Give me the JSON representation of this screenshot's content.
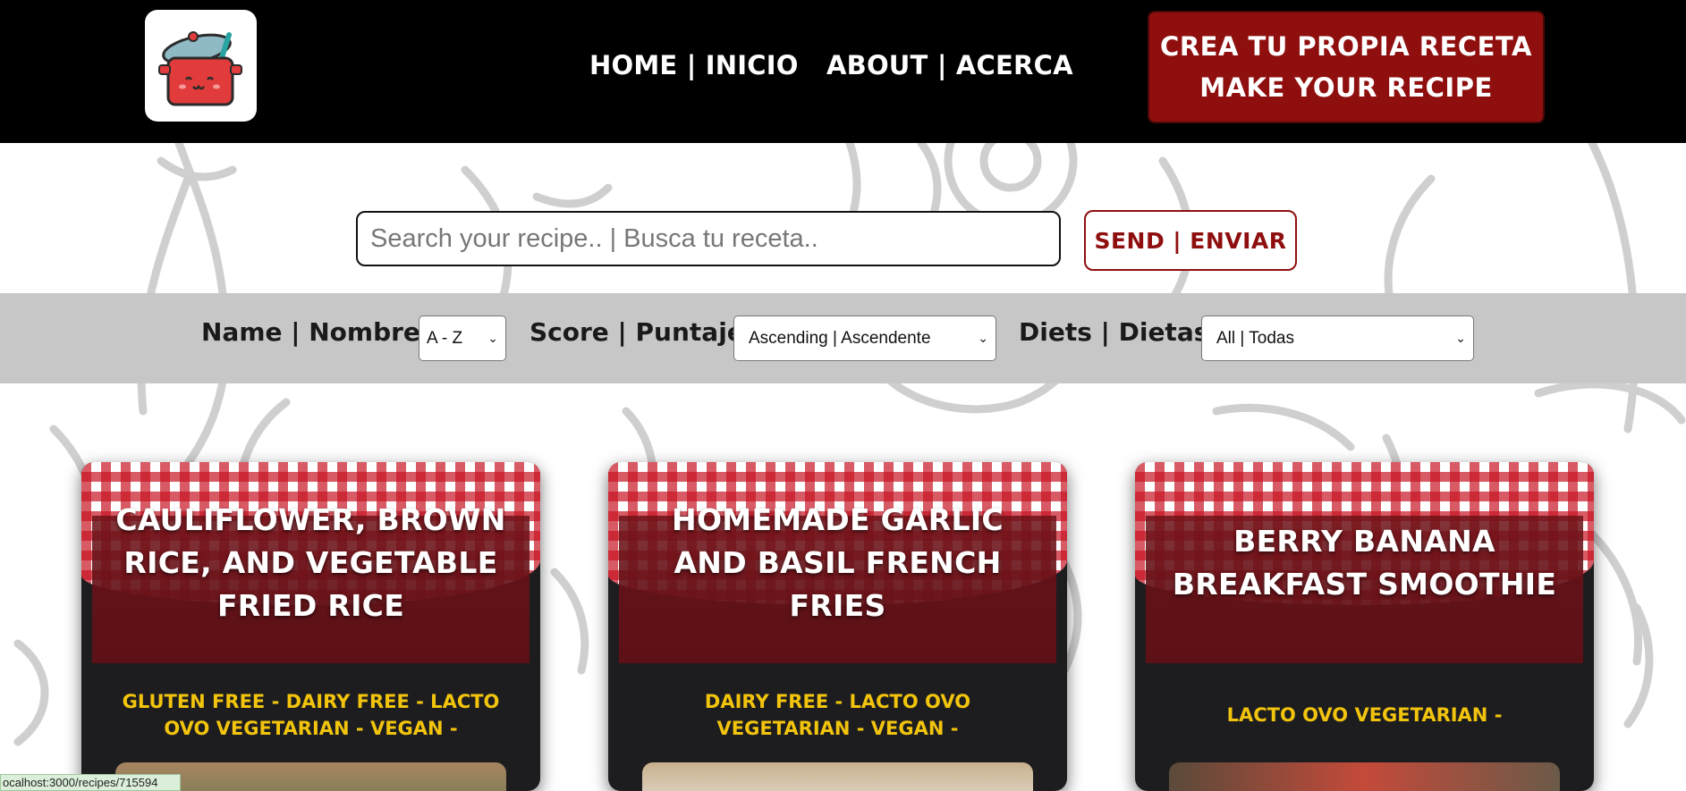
{
  "header": {
    "nav": [
      {
        "label": "HOME | INICIO"
      },
      {
        "label": "ABOUT | ACERCA"
      }
    ],
    "cta_line1": "CREA TU PROPIA RECETA",
    "cta_line2": "MAKE YOUR RECIPE"
  },
  "search": {
    "placeholder": "Search your recipe.. | Busca tu receta..",
    "send_label": "SEND | ENVIAR"
  },
  "filters": {
    "name_label": "Name | Nombre",
    "name_value": "A - Z",
    "score_label": "Score | Puntaje",
    "score_value": "Ascending | Ascendente",
    "diets_label": "Diets | Dietas",
    "diets_value": "All | Todas"
  },
  "cards": [
    {
      "title": "CAULIFLOWER, BROWN RICE, AND VEGETABLE FRIED RICE",
      "diets": "GLUTEN FREE - DAIRY FREE - LACTO OVO VEGETARIAN - VEGAN -"
    },
    {
      "title": "HOMEMADE GARLIC AND BASIL FRENCH FRIES",
      "diets": "DAIRY FREE - LACTO OVO VEGETARIAN - VEGAN -"
    },
    {
      "title": "BERRY BANANA BREAKFAST SMOOTHIE",
      "diets": "LACTO OVO VEGETARIAN -"
    }
  ],
  "status_bar": "ocalhost:3000/recipes/715594",
  "colors": {
    "header_bg": "#000000",
    "accent_red": "#8f0f0f",
    "filter_bar": "#c8c7c8",
    "diet_yellow": "#f2c40d"
  },
  "icons": [
    "cooking-pot-logo"
  ]
}
